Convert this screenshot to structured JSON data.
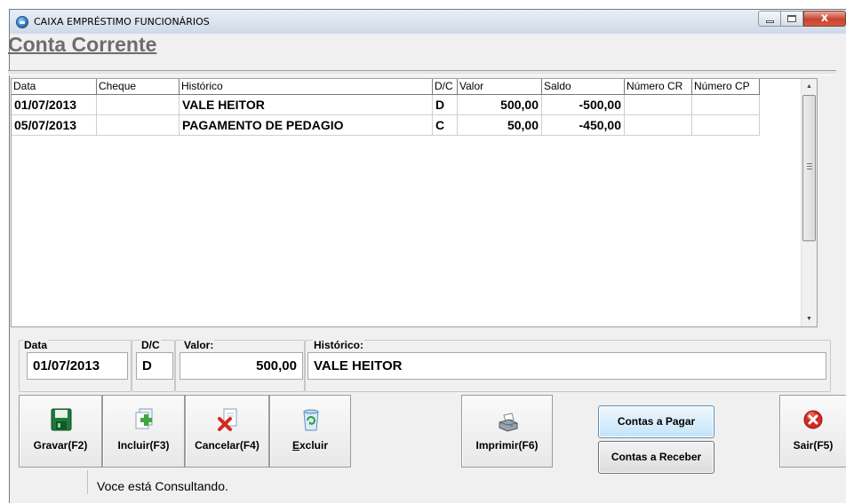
{
  "window": {
    "title": "CAIXA EMPRÉSTIMO FUNCIONÁRIOS",
    "close_glyph": "x"
  },
  "heading": "Conta Corrente",
  "grid": {
    "columns": [
      "Data",
      "Cheque",
      "Histórico",
      "D/C",
      "Valor",
      "Saldo",
      "Número CR",
      "Número CP"
    ],
    "rows": [
      {
        "data": "01/07/2013",
        "cheque": "",
        "historico": "VALE HEITOR",
        "dc": "D",
        "valor": "500,00",
        "saldo": "-500,00",
        "numero_cr": "",
        "numero_cp": ""
      },
      {
        "data": "05/07/2013",
        "cheque": "",
        "historico": "PAGAMENTO DE PEDAGIO",
        "dc": "C",
        "valor": "50,00",
        "saldo": "-450,00",
        "numero_cr": "",
        "numero_cp": ""
      }
    ],
    "scroll_up_glyph": "▲",
    "scroll_down_glyph": "▼"
  },
  "form": {
    "data_label": "Data",
    "data_value": "01/07/2013",
    "dc_label": "D/C",
    "dc_value": "D",
    "valor_label": "Valor:",
    "valor_value": "500,00",
    "historico_label": "Histórico:",
    "historico_value": "VALE HEITOR"
  },
  "buttons": {
    "gravar": "Gravar(F2)",
    "incluir": "Incluir(F3)",
    "cancelar": "Cancelar(F4)",
    "excluir_underlined": "E",
    "excluir_rest": "xcluir",
    "imprimir": "Imprimir(F6)",
    "contas_pagar": "Contas a Pagar",
    "contas_receber": "Contas a Receber",
    "sair": "Sair(F5)"
  },
  "icons": {
    "gravar": "floppy-disk-icon",
    "incluir": "add-document-icon",
    "cancelar": "cancel-document-icon",
    "excluir": "recycle-bin-icon",
    "imprimir": "printer-icon",
    "sair": "exit-icon"
  },
  "colors": {
    "heading": "#6d6d6d",
    "primary_button": "#c4e4f8",
    "exit_red": "#d42a1e"
  },
  "status": "Voce está Consultando."
}
